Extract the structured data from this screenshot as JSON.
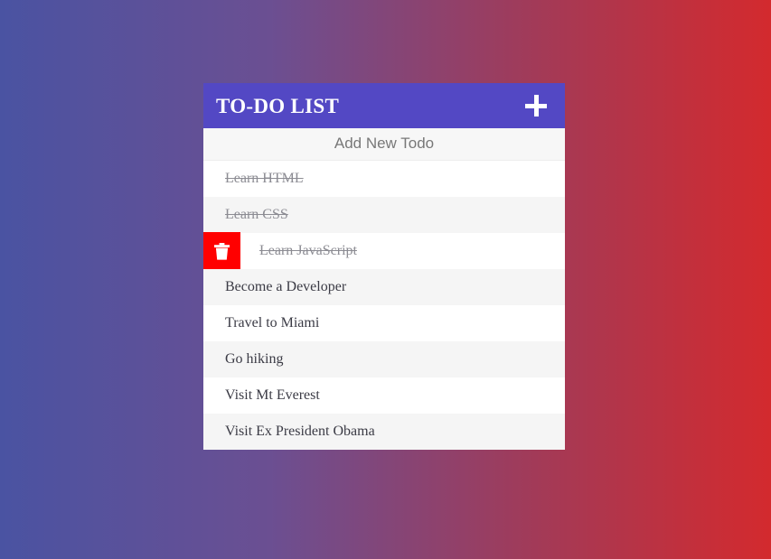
{
  "app": {
    "background_gradient_from": "#4a53a2",
    "background_gradient_to": "#d32a2e"
  },
  "header": {
    "title": "TO-DO LIST",
    "accent_color": "#5348c4",
    "add_icon": "plus-icon"
  },
  "add_form": {
    "value": "",
    "placeholder": "Add New Todo"
  },
  "delete": {
    "icon": "trash-icon",
    "color": "#ff0000"
  },
  "todos": [
    {
      "label": "Learn HTML",
      "completed": true,
      "show_delete": false
    },
    {
      "label": "Learn CSS",
      "completed": true,
      "show_delete": false
    },
    {
      "label": "Learn JavaScript",
      "completed": true,
      "show_delete": true
    },
    {
      "label": "Become a Developer",
      "completed": false,
      "show_delete": false
    },
    {
      "label": "Travel to Miami",
      "completed": false,
      "show_delete": false
    },
    {
      "label": "Go hiking",
      "completed": false,
      "show_delete": false
    },
    {
      "label": "Visit Mt Everest",
      "completed": false,
      "show_delete": false
    },
    {
      "label": "Visit Ex President Obama",
      "completed": false,
      "show_delete": false
    }
  ]
}
